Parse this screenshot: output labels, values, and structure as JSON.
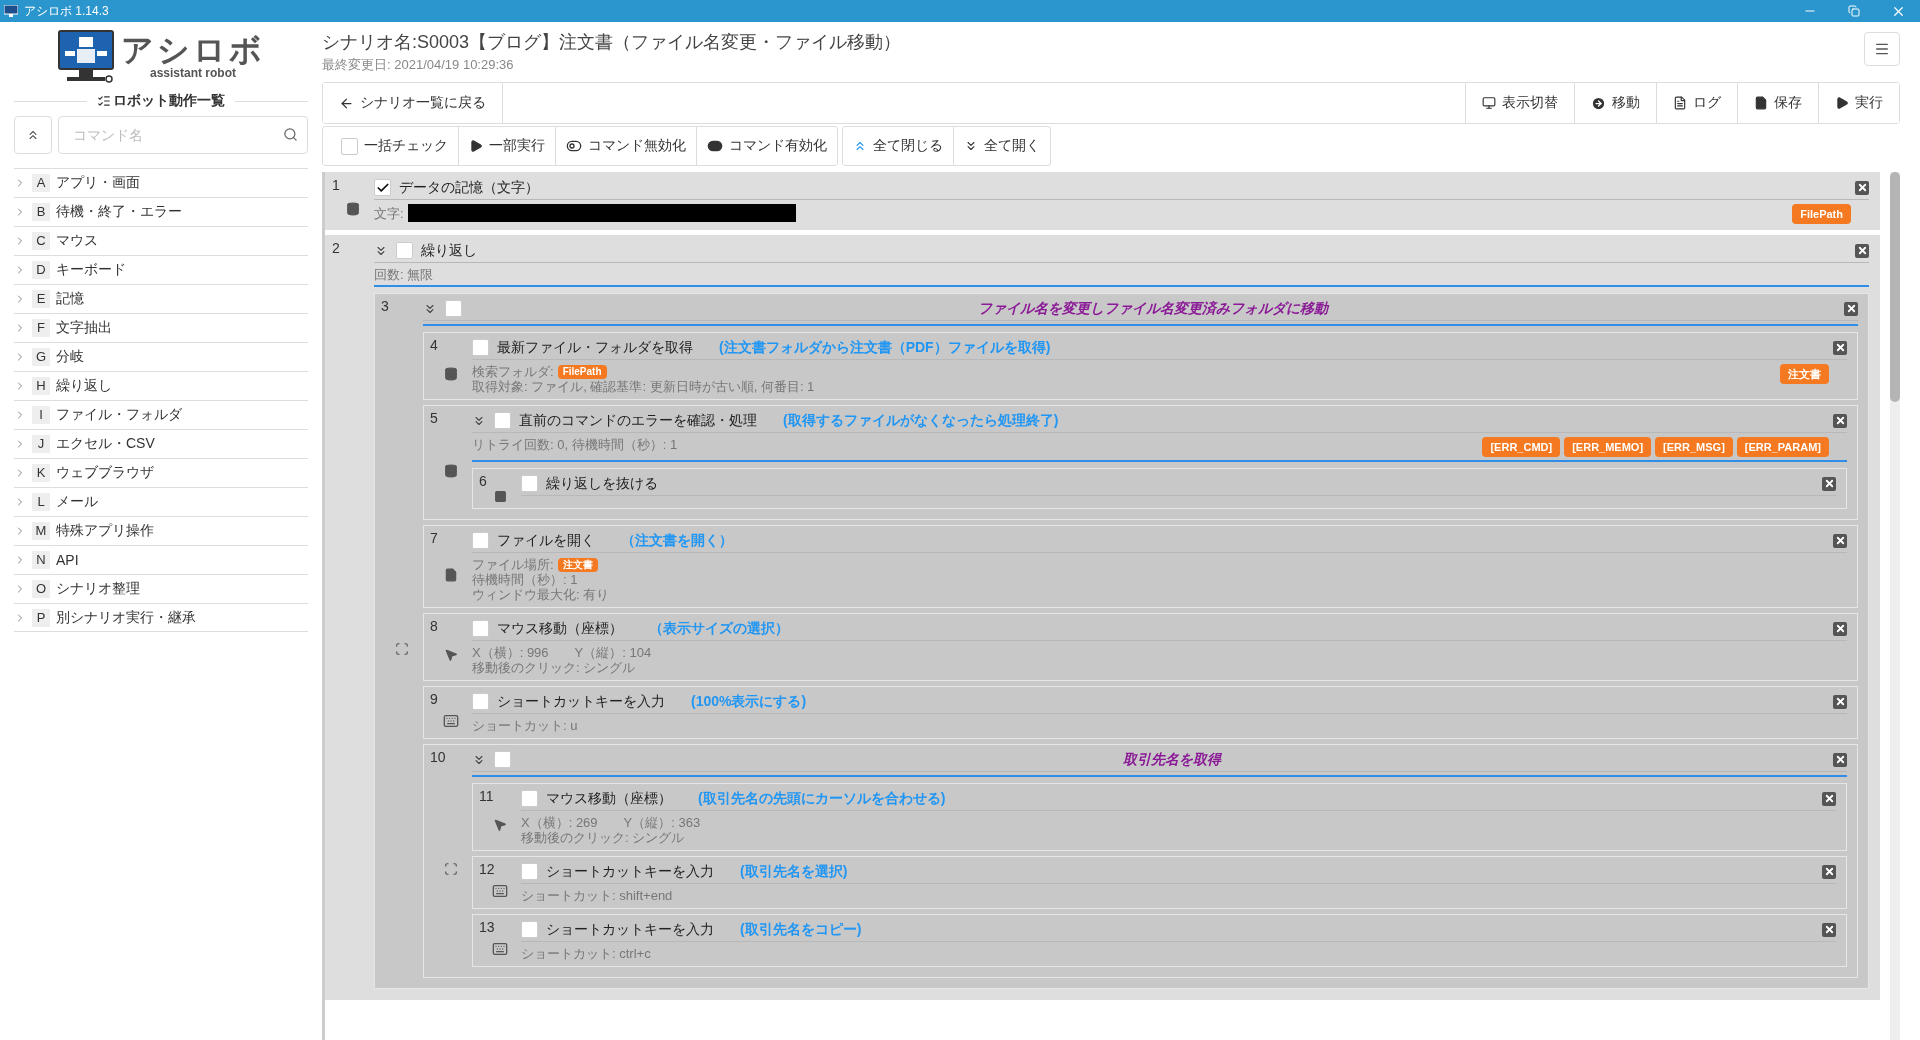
{
  "window": {
    "title": "アシロボ 1.14.3"
  },
  "logo": {
    "name": "アシロボ",
    "tagline": "assistant robot"
  },
  "sidebar": {
    "heading": "ロボット動作一覧",
    "search": {
      "placeholder": "コマンド名"
    },
    "categories": [
      {
        "letter": "A",
        "label": "アプリ・画面"
      },
      {
        "letter": "B",
        "label": "待機・終了・エラー"
      },
      {
        "letter": "C",
        "label": "マウス"
      },
      {
        "letter": "D",
        "label": "キーボード"
      },
      {
        "letter": "E",
        "label": "記憶"
      },
      {
        "letter": "F",
        "label": "文字抽出"
      },
      {
        "letter": "G",
        "label": "分岐"
      },
      {
        "letter": "H",
        "label": "繰り返し"
      },
      {
        "letter": "I",
        "label": "ファイル・フォルダ"
      },
      {
        "letter": "J",
        "label": "エクセル・CSV"
      },
      {
        "letter": "K",
        "label": "ウェブブラウザ"
      },
      {
        "letter": "L",
        "label": "メール"
      },
      {
        "letter": "M",
        "label": "特殊アプリ操作"
      },
      {
        "letter": "N",
        "label": "API"
      },
      {
        "letter": "O",
        "label": "シナリオ整理"
      },
      {
        "letter": "P",
        "label": "別シナリオ実行・継承"
      }
    ]
  },
  "scenario": {
    "title": "シナリオ名:S0003【ブログ】注文書（ファイル名変更・ファイル移動）",
    "modified": "最終変更日: 2021/04/19 10:29:36"
  },
  "toolbar": {
    "back": "シナリオ一覧に戻る",
    "actions": [
      {
        "kind": "view",
        "label": "表示切替"
      },
      {
        "kind": "move",
        "label": "移動"
      },
      {
        "kind": "log",
        "label": "ログ"
      },
      {
        "kind": "save",
        "label": "保存"
      },
      {
        "kind": "run",
        "label": "実行"
      }
    ]
  },
  "bulk_bar": {
    "check_all": {
      "label": "一括チェック",
      "checked": false
    },
    "edit_buttons": [
      {
        "kind": "run-part",
        "label": "一部実行"
      },
      {
        "kind": "disable",
        "label": "コマンド無効化"
      },
      {
        "kind": "enable",
        "label": "コマンド有効化"
      }
    ],
    "fold_buttons": [
      {
        "kind": "collapse",
        "label": "全て閉じる"
      },
      {
        "kind": "expand",
        "label": "全て開く"
      }
    ]
  },
  "commands": [
    {
      "number": "1",
      "kind": "store",
      "checked": true,
      "title": "データの記憶（文字）",
      "lines": [
        {
          "text": "文字:",
          "redacted": true
        }
      ],
      "tags": [
        "FilePath"
      ]
    },
    {
      "number": "2",
      "kind": "loop",
      "checked": false,
      "expanded": true,
      "title": "繰り返し",
      "lines": [
        {
          "text": "回数: 無限"
        }
      ],
      "children": [
        {
          "number": "3",
          "kind": "group",
          "checked": false,
          "expanded": true,
          "memo": "ファイル名を変更しファイル名変更済みフォルダに移動",
          "children": [
            {
              "number": "4",
              "kind": "get-file",
              "checked": false,
              "title": "最新ファイル・フォルダを取得",
              "memo": "(注文書フォルダから注文書（PDF）ファイルを取得)",
              "lines": [
                {
                  "text": "検索フォルダ:",
                  "tag": "FilePath"
                },
                {
                  "text": "取得対象: ファイル, 確認基準: 更新日時が古い順, 何番目: 1"
                }
              ],
              "tags": [
                "注文書"
              ]
            },
            {
              "number": "5",
              "kind": "error-check",
              "checked": false,
              "expanded": true,
              "title": "直前のコマンドのエラーを確認・処理",
              "memo": "(取得するファイルがなくなったら処理終了)",
              "lines": [
                {
                  "text": "リトライ回数: 0, 待機時間（秒）: 1"
                }
              ],
              "tags": [
                "[ERR_CMD]",
                "[ERR_MEMO]",
                "[ERR_MSG]",
                "[ERR_PARAM]"
              ],
              "children": [
                {
                  "number": "6",
                  "kind": "break",
                  "checked": false,
                  "title": "繰り返しを抜ける"
                }
              ]
            },
            {
              "number": "7",
              "kind": "open-file",
              "checked": false,
              "title": "ファイルを開く",
              "memo": "（注文書を開く）",
              "lines": [
                {
                  "text": "ファイル場所:",
                  "tag": "注文書"
                },
                {
                  "text": "待機時間（秒）: 1"
                },
                {
                  "text": "ウィンドウ最大化: 有り"
                }
              ]
            },
            {
              "number": "8",
              "kind": "mouse",
              "checked": false,
              "title": "マウス移動（座標）",
              "memo": "（表示サイズの選択）",
              "lines": [
                {
                  "text": "X（横）: 996　　Y（縦）: 104"
                },
                {
                  "text": "移動後のクリック: シングル"
                }
              ]
            },
            {
              "number": "9",
              "kind": "shortcut",
              "checked": false,
              "title": "ショートカットキーを入力",
              "memo": "(100%表示にする)",
              "lines": [
                {
                  "text": "ショートカット: u"
                }
              ]
            },
            {
              "number": "10",
              "kind": "group",
              "checked": false,
              "expanded": true,
              "memo": "取引先名を取得",
              "children": [
                {
                  "number": "11",
                  "kind": "mouse",
                  "checked": false,
                  "title": "マウス移動（座標）",
                  "memo": "(取引先名の先頭にカーソルを合わせる)",
                  "lines": [
                    {
                      "text": "X（横）: 269　　Y（縦）: 363"
                    },
                    {
                      "text": "移動後のクリック: シングル"
                    }
                  ]
                },
                {
                  "number": "12",
                  "kind": "shortcut",
                  "checked": false,
                  "title": "ショートカットキーを入力",
                  "memo": "(取引先名を選択)",
                  "lines": [
                    {
                      "text": "ショートカット: shift+end"
                    }
                  ]
                },
                {
                  "number": "13",
                  "kind": "shortcut",
                  "checked": false,
                  "title": "ショートカットキーを入力",
                  "memo": "(取引先名をコピー)",
                  "lines": [
                    {
                      "text": "ショートカット: ctrl+c"
                    }
                  ]
                }
              ]
            }
          ]
        }
      ]
    }
  ]
}
